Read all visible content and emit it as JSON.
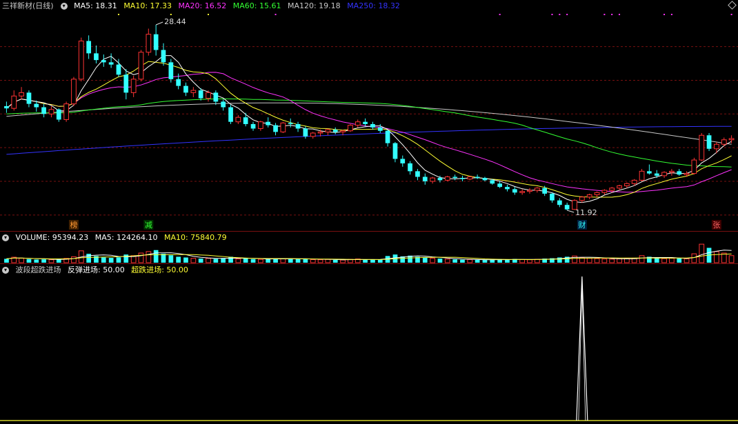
{
  "main_legend": {
    "title": "三祥新材(日线)",
    "items": [
      {
        "label": "MA5: 18.31",
        "color": "#ffffff"
      },
      {
        "label": "MA10: 17.33",
        "color": "#ffff33"
      },
      {
        "label": "MA20: 16.52",
        "color": "#ff33ff"
      },
      {
        "label": "MA60: 15.61",
        "color": "#33ff33"
      },
      {
        "label": "MA120: 19.18",
        "color": "#c8c8c8"
      },
      {
        "label": "MA250: 18.32",
        "color": "#3333ff"
      }
    ]
  },
  "volume_legend": {
    "items": [
      {
        "label": "VOLUME: 95394.23",
        "color": "#ffffff"
      },
      {
        "label": "MA5: 124264.10",
        "color": "#ffffff"
      },
      {
        "label": "MA10: 75840.79",
        "color": "#ffff33"
      }
    ]
  },
  "indicator_legend": {
    "items": [
      {
        "label": "波段超跌进场",
        "color": "#c8c8c8"
      },
      {
        "label": "反弹进场: 50.00",
        "color": "#ffffff"
      },
      {
        "label": "超跌进场: 50.00",
        "color": "#ffff33"
      }
    ]
  },
  "colors": {
    "up": "#ff3333",
    "down": "#33ffff",
    "grid": "#7a1010",
    "ma5": "#ffffff",
    "ma10": "#ffff33",
    "ma20": "#ff33ff",
    "ma60": "#33ff33",
    "ma120": "#c8c8c8",
    "ma250": "#3333ff"
  },
  "annotations": {
    "high": "28.44",
    "low": "11.92",
    "markers": [
      "榜",
      "减",
      "财",
      "张"
    ]
  },
  "chart_data": [
    {
      "type": "candlestick",
      "title": "三祥新材(日线)",
      "high_label": 28.44,
      "low_label": 11.92,
      "ohlc_rows": [
        [
          21.2,
          21.6,
          20.6,
          21.0
        ],
        [
          21.0,
          22.6,
          20.8,
          22.1
        ],
        [
          22.1,
          22.9,
          21.8,
          22.4
        ],
        [
          22.4,
          22.6,
          21.1,
          21.4
        ],
        [
          21.4,
          21.7,
          20.7,
          21.1
        ],
        [
          21.1,
          21.4,
          20.2,
          20.5
        ],
        [
          20.5,
          21.2,
          20.2,
          20.9
        ],
        [
          20.9,
          21.0,
          19.8,
          20.0
        ],
        [
          20.0,
          21.6,
          19.8,
          21.4
        ],
        [
          21.4,
          23.8,
          21.2,
          23.6
        ],
        [
          23.6,
          27.3,
          23.4,
          27.0
        ],
        [
          27.0,
          27.5,
          25.4,
          25.9
        ],
        [
          25.9,
          26.6,
          25.0,
          25.3
        ],
        [
          25.3,
          25.8,
          24.7,
          25.1
        ],
        [
          25.1,
          25.9,
          24.6,
          24.9
        ],
        [
          24.9,
          25.4,
          23.8,
          24.0
        ],
        [
          24.0,
          24.5,
          21.8,
          22.4
        ],
        [
          22.4,
          23.9,
          22.0,
          23.6
        ],
        [
          23.6,
          26.2,
          23.4,
          26.0
        ],
        [
          26.0,
          28.1,
          25.7,
          27.6
        ],
        [
          27.6,
          28.44,
          25.7,
          26.2
        ],
        [
          26.2,
          26.8,
          24.8,
          25.1
        ],
        [
          25.1,
          25.4,
          23.3,
          23.6
        ],
        [
          23.6,
          24.1,
          22.7,
          23.0
        ],
        [
          23.0,
          23.3,
          22.1,
          22.4
        ],
        [
          22.4,
          22.9,
          22.0,
          22.6
        ],
        [
          22.6,
          22.8,
          21.7,
          21.9
        ],
        [
          21.9,
          22.6,
          21.6,
          22.4
        ],
        [
          22.4,
          22.6,
          21.3,
          21.6
        ],
        [
          21.6,
          21.8,
          20.8,
          21.1
        ],
        [
          21.1,
          21.3,
          19.6,
          19.8
        ],
        [
          19.8,
          20.4,
          19.6,
          20.2
        ],
        [
          20.2,
          20.6,
          19.4,
          19.6
        ],
        [
          19.6,
          19.8,
          19.0,
          19.2
        ],
        [
          19.2,
          19.9,
          19.0,
          19.8
        ],
        [
          19.8,
          20.2,
          19.3,
          19.5
        ],
        [
          19.5,
          19.7,
          18.6,
          18.9
        ],
        [
          18.9,
          19.8,
          18.8,
          19.7
        ],
        [
          19.7,
          20.1,
          19.3,
          19.6
        ],
        [
          19.6,
          19.8,
          18.9,
          19.2
        ],
        [
          19.2,
          19.4,
          18.3,
          18.5
        ],
        [
          18.5,
          18.9,
          18.3,
          18.8
        ],
        [
          18.8,
          19.1,
          18.5,
          18.9
        ],
        [
          18.9,
          19.2,
          18.6,
          19.1
        ],
        [
          19.1,
          19.3,
          18.7,
          18.9
        ],
        [
          18.9,
          19.1,
          18.6,
          19.0
        ],
        [
          19.0,
          19.6,
          18.9,
          19.5
        ],
        [
          19.5,
          20.0,
          19.3,
          19.8
        ],
        [
          19.8,
          20.1,
          19.4,
          19.6
        ],
        [
          19.6,
          19.8,
          19.1,
          19.3
        ],
        [
          19.3,
          19.6,
          18.8,
          19.0
        ],
        [
          19.0,
          19.1,
          17.6,
          17.9
        ],
        [
          17.9,
          18.0,
          16.2,
          16.5
        ],
        [
          16.5,
          16.8,
          15.8,
          16.1
        ],
        [
          16.1,
          16.3,
          15.1,
          15.4
        ],
        [
          15.4,
          15.6,
          14.6,
          14.9
        ],
        [
          14.9,
          15.2,
          14.2,
          14.5
        ],
        [
          14.5,
          14.9,
          14.3,
          14.8
        ],
        [
          14.8,
          15.0,
          14.4,
          14.6
        ],
        [
          14.6,
          15.0,
          14.5,
          14.9
        ],
        [
          14.9,
          15.1,
          14.6,
          14.8
        ],
        [
          14.8,
          15.0,
          14.5,
          14.7
        ],
        [
          14.7,
          15.0,
          14.6,
          14.9
        ],
        [
          14.9,
          15.1,
          14.7,
          14.8
        ],
        [
          14.8,
          14.9,
          14.5,
          14.6
        ],
        [
          14.6,
          14.7,
          14.2,
          14.3
        ],
        [
          14.3,
          14.5,
          13.9,
          14.0
        ],
        [
          14.0,
          14.2,
          13.6,
          13.8
        ],
        [
          13.8,
          14.0,
          13.3,
          13.5
        ],
        [
          13.5,
          13.8,
          13.3,
          13.6
        ],
        [
          13.6,
          13.9,
          13.4,
          13.7
        ],
        [
          13.7,
          14.0,
          13.5,
          13.9
        ],
        [
          13.9,
          14.1,
          13.2,
          13.4
        ],
        [
          13.4,
          13.5,
          12.6,
          12.8
        ],
        [
          12.8,
          13.0,
          12.2,
          12.4
        ],
        [
          12.4,
          12.6,
          11.92,
          12.0
        ],
        [
          12.0,
          12.9,
          11.95,
          12.8
        ],
        [
          12.8,
          13.2,
          12.6,
          13.1
        ],
        [
          13.1,
          13.4,
          12.9,
          13.3
        ],
        [
          13.3,
          13.6,
          13.1,
          13.5
        ],
        [
          13.5,
          13.8,
          13.3,
          13.7
        ],
        [
          13.7,
          14.0,
          13.5,
          13.9
        ],
        [
          13.9,
          14.2,
          13.7,
          14.1
        ],
        [
          14.1,
          14.4,
          13.9,
          14.3
        ],
        [
          14.3,
          14.7,
          14.1,
          14.6
        ],
        [
          14.6,
          15.6,
          14.5,
          15.4
        ],
        [
          15.4,
          16.0,
          15.1,
          15.2
        ],
        [
          15.2,
          15.5,
          14.8,
          15.0
        ],
        [
          15.0,
          15.4,
          14.8,
          15.3
        ],
        [
          15.3,
          15.6,
          15.0,
          15.4
        ],
        [
          15.4,
          15.6,
          15.0,
          15.1
        ],
        [
          15.1,
          15.4,
          14.9,
          15.2
        ],
        [
          15.2,
          16.6,
          15.1,
          16.4
        ],
        [
          16.4,
          18.8,
          16.3,
          18.6
        ],
        [
          18.6,
          18.8,
          17.2,
          17.4
        ],
        [
          17.4,
          18.0,
          17.0,
          17.8
        ],
        [
          17.8,
          18.4,
          17.6,
          18.2
        ],
        [
          18.2,
          18.6,
          17.9,
          18.31
        ]
      ],
      "ma5": 18.31,
      "ma10": 17.33,
      "ma20": 16.52,
      "ma60": 15.61,
      "ma120": 19.18,
      "ma250": 18.32
    },
    {
      "type": "bar",
      "title": "VOLUME",
      "volume": 95394.23,
      "ma5": 124264.1,
      "ma10": 75840.79,
      "values": [
        52000,
        74000,
        60000,
        48000,
        42000,
        45000,
        40000,
        50000,
        58000,
        80000,
        160000,
        120000,
        90000,
        70000,
        65000,
        72000,
        110000,
        95000,
        130000,
        150000,
        170000,
        120000,
        100000,
        80000,
        70000,
        60000,
        55000,
        58000,
        52000,
        62000,
        80000,
        50000,
        56000,
        48000,
        45000,
        50000,
        60000,
        55000,
        50000,
        48000,
        52000,
        42000,
        40000,
        44000,
        38000,
        36000,
        45000,
        50000,
        40000,
        42000,
        45000,
        90000,
        110000,
        85000,
        95000,
        80000,
        70000,
        60000,
        55000,
        48000,
        45000,
        40000,
        42000,
        38000,
        36000,
        40000,
        48000,
        45000,
        50000,
        42000,
        40000,
        45000,
        55000,
        60000,
        70000,
        80000,
        90000,
        70000,
        60000,
        55000,
        50000,
        48000,
        52000,
        56000,
        60000,
        95000,
        80000,
        60000,
        55000,
        60000,
        58000,
        52000,
        120000,
        250000,
        200000,
        150000,
        130000,
        95394
      ]
    },
    {
      "type": "line",
      "title": "波段超跌进场",
      "series": [
        {
          "name": "反弹进场",
          "value": 50.0
        },
        {
          "name": "超跌进场",
          "value": 50.0
        }
      ],
      "signal_bar": 77
    }
  ]
}
